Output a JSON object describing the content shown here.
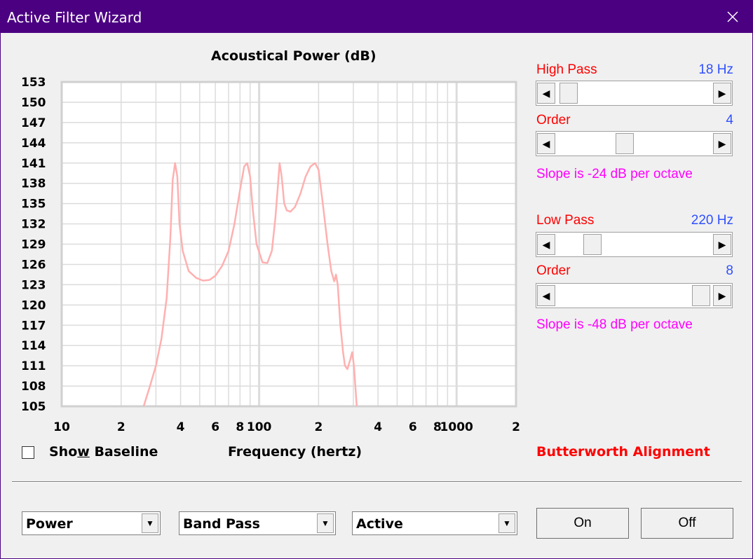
{
  "window": {
    "title": "Active Filter Wizard"
  },
  "chart_data": {
    "type": "line",
    "title": "Acoustical Power (dB)",
    "xlabel": "Frequency (hertz)",
    "ylabel": "",
    "x_scale": "log",
    "xlim": [
      10,
      2000
    ],
    "ylim": [
      105,
      153
    ],
    "y_ticks": [
      "153",
      "150",
      "147",
      "144",
      "141",
      "138",
      "135",
      "132",
      "129",
      "126",
      "123",
      "120",
      "117",
      "114",
      "111",
      "108",
      "105"
    ],
    "x_tick_values": [
      10,
      20,
      40,
      60,
      80,
      100,
      200,
      400,
      600,
      800,
      1000,
      2000
    ],
    "x_tick_labels": [
      "10",
      "2",
      "4",
      "6",
      "8",
      "100",
      "2",
      "4",
      "6",
      "8",
      "1000",
      "2"
    ],
    "grid": true,
    "series": [
      {
        "color": "#ffb0b0",
        "points": [
          [
            26,
            105
          ],
          [
            28,
            108
          ],
          [
            30,
            111
          ],
          [
            32,
            115
          ],
          [
            34,
            121
          ],
          [
            35.5,
            130
          ],
          [
            36.5,
            138.5
          ],
          [
            37.5,
            141
          ],
          [
            38.5,
            139
          ],
          [
            39.5,
            132
          ],
          [
            41,
            128
          ],
          [
            44,
            125
          ],
          [
            48,
            124
          ],
          [
            52,
            123.6
          ],
          [
            56,
            123.7
          ],
          [
            60,
            124.3
          ],
          [
            65,
            125.8
          ],
          [
            70,
            128
          ],
          [
            75,
            132
          ],
          [
            80,
            137
          ],
          [
            84,
            140.5
          ],
          [
            87,
            141
          ],
          [
            90,
            139
          ],
          [
            93,
            134
          ],
          [
            97,
            129
          ],
          [
            104,
            126.3
          ],
          [
            110,
            126.2
          ],
          [
            116,
            128
          ],
          [
            121,
            133
          ],
          [
            124,
            137
          ],
          [
            127,
            141
          ],
          [
            130,
            139
          ],
          [
            134,
            135
          ],
          [
            138,
            134
          ],
          [
            144,
            133.8
          ],
          [
            152,
            134.5
          ],
          [
            162,
            136.5
          ],
          [
            172,
            139
          ],
          [
            182,
            140.5
          ],
          [
            192,
            141
          ],
          [
            200,
            140
          ],
          [
            210,
            135
          ],
          [
            222,
            129
          ],
          [
            232,
            125
          ],
          [
            240,
            123.5
          ],
          [
            245,
            124.5
          ],
          [
            250,
            123
          ],
          [
            258,
            117
          ],
          [
            266,
            113
          ],
          [
            272,
            111
          ],
          [
            280,
            110.5
          ],
          [
            290,
            112
          ],
          [
            296,
            113
          ],
          [
            302,
            111
          ],
          [
            312,
            105
          ]
        ]
      }
    ]
  },
  "controls": {
    "high_pass_label": "High Pass",
    "high_pass_value": "18 Hz",
    "high_pass_order_label": "Order",
    "high_pass_order_value": "4",
    "high_pass_slope": "Slope is -24 dB per octave",
    "low_pass_label": "Low Pass",
    "low_pass_value": "220 Hz",
    "low_pass_order_label": "Order",
    "low_pass_order_value": "8",
    "low_pass_slope": "Slope is -48 dB per octave",
    "high_pass_slider": 0.03,
    "high_pass_order_slider": 0.43,
    "low_pass_slider": 0.2,
    "low_pass_order_slider": 0.98
  },
  "show_baseline": {
    "label_pre": "Sho",
    "label_u": "w",
    "label_post": " Baseline",
    "checked": false
  },
  "alignment": "Butterworth Alignment",
  "dropdowns": {
    "mode": "Power",
    "filter_type": "Band Pass",
    "filter_kind": "Active"
  },
  "buttons": {
    "on": "On",
    "off": "Off"
  },
  "icons": {
    "close": "close-icon",
    "arrow_left": "arrow-left-icon",
    "arrow_right": "arrow-right-icon",
    "dropdown": "chevron-down-icon"
  }
}
